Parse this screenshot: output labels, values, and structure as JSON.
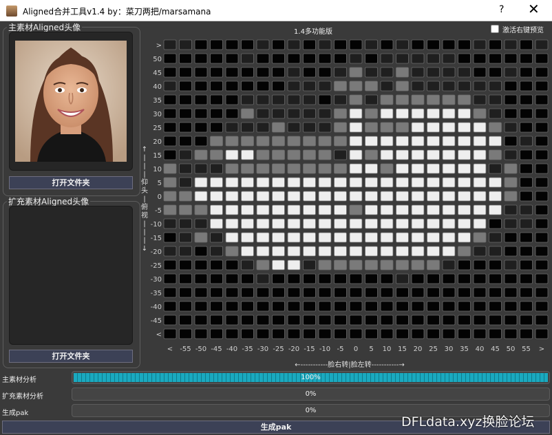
{
  "window": {
    "title": "Aligned合并工具v1.4  by：菜刀两把/marsamana",
    "help_glyph": "?",
    "close_glyph": "✕"
  },
  "main_panel": {
    "title": "主素材Aligned头像",
    "image_desc": "portrait-photo",
    "button_label": "打开文件夹"
  },
  "ext_panel": {
    "title": "扩充素材Aligned头像",
    "button_label": "打开文件夹"
  },
  "grid": {
    "header": "1.4多功能版",
    "right_click_preview": {
      "label": "激活右键预览",
      "checked": false
    },
    "vertical_label": [
      "↑",
      "|",
      "|",
      "|",
      "仰",
      "头",
      "|",
      "俯",
      "视",
      "|",
      "|",
      "|",
      "↓"
    ],
    "row_labels": [
      ">",
      "50",
      "45",
      "40",
      "35",
      "30",
      "25",
      "20",
      "15",
      "10",
      "5",
      "0",
      "-5",
      "-10",
      "-15",
      "-20",
      "-25",
      "-30",
      "-35",
      "-40",
      "-45",
      "<"
    ],
    "col_labels": [
      "<",
      "-55",
      "-50",
      "-45",
      "-40",
      "-35",
      "-30",
      "-25",
      "-20",
      "-15",
      "-10",
      "-5",
      "0",
      "5",
      "10",
      "15",
      "20",
      "25",
      "30",
      "35",
      "40",
      "45",
      "50",
      "55",
      ">"
    ],
    "horizontal_label": "←-----------脸右转|脸左转-----------→",
    "levels_legend": {
      "0": "empty",
      "1": "low",
      "2": "medium",
      "3": "high"
    },
    "colors": {
      "0": "#030303",
      "1": "#1f1f1f",
      "2": "#7a7a7a",
      "3": "#eeeeee"
    },
    "cells": [
      [
        1,
        1,
        0,
        0,
        0,
        0,
        1,
        0,
        1,
        0,
        1,
        0,
        0,
        1,
        0,
        1,
        0,
        0,
        0,
        0,
        1,
        0,
        1,
        0,
        1
      ],
      [
        0,
        0,
        0,
        0,
        0,
        1,
        0,
        0,
        0,
        0,
        0,
        0,
        1,
        0,
        1,
        1,
        1,
        1,
        1,
        0,
        0,
        0,
        0,
        0,
        0
      ],
      [
        0,
        0,
        0,
        0,
        0,
        0,
        0,
        0,
        1,
        0,
        0,
        1,
        2,
        1,
        1,
        2,
        1,
        1,
        1,
        1,
        0,
        0,
        1,
        0,
        0
      ],
      [
        1,
        0,
        0,
        0,
        0,
        0,
        0,
        0,
        1,
        1,
        1,
        2,
        2,
        2,
        1,
        2,
        1,
        1,
        1,
        1,
        1,
        1,
        0,
        0,
        0
      ],
      [
        0,
        0,
        0,
        0,
        0,
        1,
        1,
        1,
        1,
        1,
        0,
        1,
        2,
        1,
        2,
        2,
        2,
        2,
        2,
        2,
        1,
        1,
        0,
        0,
        0
      ],
      [
        0,
        0,
        0,
        0,
        0,
        2,
        1,
        1,
        1,
        1,
        1,
        2,
        3,
        2,
        3,
        3,
        3,
        3,
        3,
        3,
        2,
        1,
        0,
        0,
        0
      ],
      [
        0,
        0,
        0,
        0,
        1,
        1,
        1,
        2,
        1,
        1,
        1,
        2,
        3,
        2,
        2,
        2,
        3,
        3,
        3,
        3,
        3,
        2,
        1,
        0,
        0
      ],
      [
        0,
        0,
        0,
        2,
        2,
        2,
        2,
        2,
        2,
        2,
        2,
        2,
        3,
        3,
        3,
        3,
        3,
        3,
        3,
        3,
        3,
        3,
        0,
        1,
        0
      ],
      [
        0,
        1,
        2,
        2,
        3,
        3,
        2,
        2,
        2,
        2,
        2,
        1,
        3,
        2,
        3,
        3,
        3,
        3,
        3,
        3,
        3,
        2,
        1,
        0,
        0
      ],
      [
        2,
        1,
        1,
        1,
        2,
        2,
        2,
        2,
        2,
        2,
        2,
        2,
        3,
        3,
        2,
        3,
        3,
        3,
        3,
        3,
        3,
        1,
        2,
        0,
        0
      ],
      [
        2,
        1,
        3,
        3,
        3,
        3,
        3,
        3,
        3,
        3,
        3,
        3,
        3,
        3,
        3,
        3,
        3,
        3,
        3,
        3,
        3,
        3,
        2,
        0,
        0
      ],
      [
        2,
        2,
        3,
        3,
        3,
        3,
        3,
        3,
        3,
        3,
        3,
        3,
        3,
        3,
        3,
        3,
        3,
        3,
        3,
        3,
        3,
        3,
        2,
        0,
        0
      ],
      [
        2,
        2,
        2,
        3,
        3,
        3,
        3,
        3,
        3,
        3,
        3,
        3,
        2,
        3,
        3,
        3,
        3,
        3,
        3,
        3,
        3,
        3,
        1,
        1,
        0
      ],
      [
        1,
        1,
        1,
        3,
        3,
        3,
        3,
        3,
        3,
        3,
        3,
        3,
        3,
        3,
        3,
        3,
        3,
        3,
        3,
        3,
        3,
        0,
        1,
        1,
        0
      ],
      [
        0,
        1,
        2,
        1,
        3,
        3,
        3,
        3,
        3,
        3,
        3,
        3,
        3,
        3,
        3,
        3,
        3,
        3,
        3,
        3,
        2,
        1,
        0,
        0,
        0
      ],
      [
        1,
        1,
        0,
        1,
        2,
        3,
        3,
        3,
        3,
        3,
        3,
        3,
        3,
        3,
        3,
        3,
        3,
        3,
        3,
        2,
        1,
        1,
        0,
        0,
        0
      ],
      [
        0,
        0,
        0,
        0,
        0,
        1,
        2,
        3,
        3,
        1,
        2,
        2,
        2,
        2,
        2,
        2,
        2,
        2,
        1,
        0,
        0,
        0,
        1,
        0,
        0
      ],
      [
        0,
        0,
        0,
        0,
        0,
        0,
        1,
        0,
        0,
        0,
        0,
        0,
        0,
        0,
        0,
        1,
        0,
        0,
        0,
        0,
        0,
        0,
        0,
        0,
        0
      ],
      [
        0,
        0,
        0,
        0,
        0,
        0,
        0,
        0,
        0,
        0,
        0,
        0,
        0,
        0,
        0,
        0,
        0,
        0,
        0,
        0,
        0,
        0,
        0,
        0,
        0
      ],
      [
        0,
        0,
        0,
        0,
        0,
        0,
        0,
        0,
        0,
        0,
        0,
        0,
        0,
        0,
        0,
        0,
        0,
        0,
        0,
        0,
        0,
        0,
        0,
        0,
        0
      ],
      [
        0,
        0,
        0,
        0,
        0,
        0,
        0,
        0,
        0,
        0,
        0,
        0,
        0,
        0,
        0,
        0,
        0,
        0,
        0,
        0,
        0,
        0,
        0,
        0,
        0
      ],
      [
        0,
        0,
        0,
        0,
        0,
        0,
        0,
        0,
        0,
        0,
        0,
        0,
        0,
        0,
        0,
        0,
        0,
        0,
        0,
        0,
        0,
        0,
        0,
        0,
        0
      ]
    ]
  },
  "progress": [
    {
      "label": "主素材分析",
      "value": 1.0,
      "text": "100%"
    },
    {
      "label": "扩充素材分析",
      "value": 0.0,
      "text": "0%"
    },
    {
      "label": "生成pak",
      "value": 0.0,
      "text": "0%"
    }
  ],
  "generate_button": "生成pak",
  "watermark": "DFLdata.xyz换脸论坛",
  "accent_color": "#1aa9bf"
}
